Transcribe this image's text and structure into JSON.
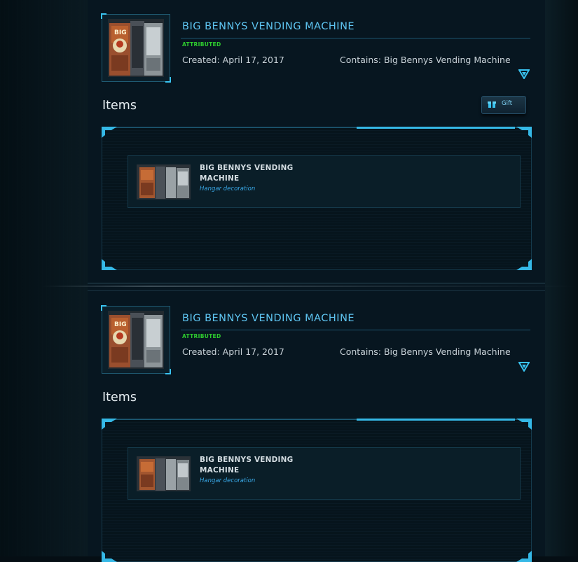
{
  "pledges": [
    {
      "title": "BIG BENNYS VENDING MACHINE",
      "status": "ATTRIBUTED",
      "created": "Created: April 17, 2017",
      "contains": "Contains: Big Bennys Vending Machine",
      "items_heading": "Items",
      "gift_label": "Gift",
      "items": [
        {
          "name": "BIG BENNYS VENDING MACHINE",
          "type": "Hangar decoration"
        }
      ]
    },
    {
      "title": "BIG BENNYS VENDING MACHINE",
      "status": "ATTRIBUTED",
      "created": "Created: April 17, 2017",
      "contains": "Contains: Big Bennys Vending Machine",
      "items_heading": "Items",
      "items": [
        {
          "name": "BIG BENNYS VENDING MACHINE",
          "type": "Hangar decoration"
        }
      ]
    }
  ],
  "colors": {
    "accent": "#39c3f0",
    "title": "#5fc6f3",
    "status": "#2ecc2e",
    "item_type": "#39a9e8"
  },
  "icons": [
    "vending-machine-image",
    "chevron-down-icon",
    "gift-icon",
    "corner-bracket-icon"
  ]
}
